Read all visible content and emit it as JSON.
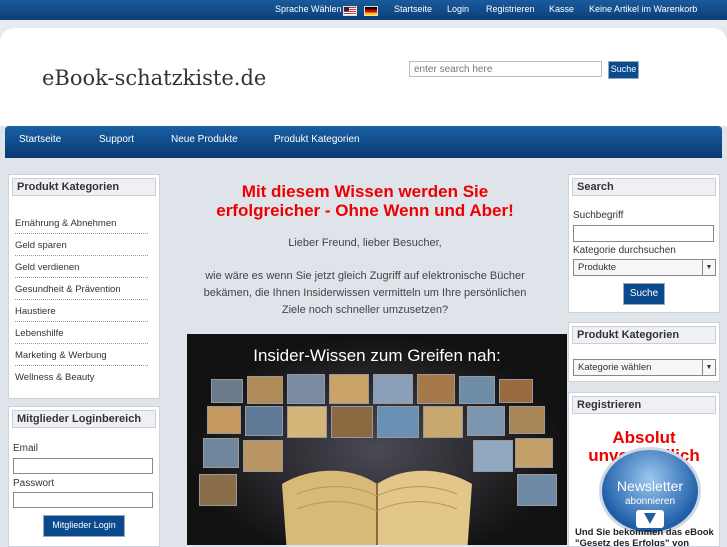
{
  "topbar": {
    "language": "Sprache Wählen",
    "links": [
      "Startseite",
      "Login",
      "Registrieren",
      "Kasse",
      "Keine Artikel im Warenkorb"
    ]
  },
  "header": {
    "logo": "eBook-schatzkiste.de",
    "search_placeholder": "enter search here",
    "search_button": "Suche"
  },
  "nav": [
    "Startseite",
    "Support",
    "Neue Produkte",
    "Produkt Kategorien"
  ],
  "left": {
    "categories_title": "Produkt Kategorien",
    "categories": [
      "Ernährung & Abnehmen",
      "Geld sparen",
      "Geld verdienen",
      "Gesundheit & Prävention",
      "Haustiere",
      "Lebenshilfe",
      "Marketing & Werbung",
      "Wellness & Beauty"
    ],
    "login_title": "Mitglieder Loginbereich",
    "email_label": "Email",
    "password_label": "Passwort",
    "login_button": "Mitglieder Login"
  },
  "main": {
    "headline_1": "Mit diesem Wissen werden Sie",
    "headline_2": "erfolgreicher - Ohne Wenn und Aber!",
    "greeting": "Lieber Freund, lieber Besucher,",
    "body_1": "wie wäre es wenn Sie jetzt gleich Zugriff auf elektronische Bücher",
    "body_2": "bekämen, die Ihnen Insiderwissen vermitteln um Ihre persönlichen",
    "body_3": "Ziele noch schneller umzusetzen?",
    "promo_title": "Insider-Wissen zum Greifen nah:"
  },
  "right": {
    "search_title": "Search",
    "search_term_label": "Suchbegriff",
    "category_label": "Kategorie durchsuchen",
    "category_value": "Produkte",
    "search_button": "Suche",
    "categories_title": "Produkt Kategorien",
    "categories_select": "Kategorie wählen",
    "register_title": "Registrieren",
    "promo_line1": "Absolut",
    "promo_line2": "unverbindlich",
    "newsletter_1": "Newsletter",
    "newsletter_2": "abonnieren",
    "ebook_1": "Und Sie bekommen das eBook",
    "ebook_2": "\"Gesetz des Erfolgs\" von"
  }
}
